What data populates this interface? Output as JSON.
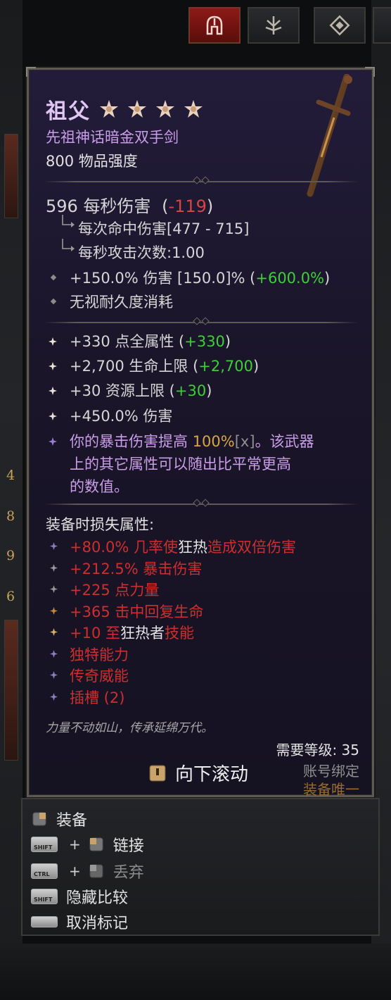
{
  "item": {
    "name": "祖父",
    "type": "先祖神话暗金双手剑",
    "power": "800 物品强度",
    "stars": 4
  },
  "dps": {
    "value": "596 每秒伤害",
    "diff_open": "(",
    "diff": "-119",
    "diff_close": ")",
    "hit_damage": "每次命中伤害[477 - 715]",
    "attacks_per_second": "每秒攻击次数:1.00"
  },
  "implicit": [
    {
      "prefix": "+150.0% 伤害 [150.0]% (",
      "green": "+600.0%",
      "suffix": ")"
    },
    {
      "prefix": "无视耐久度消耗",
      "green": "",
      "suffix": ""
    }
  ],
  "affixes": [
    {
      "prefix": "+330 点全属性 (",
      "green": "+330",
      "suffix": ")"
    },
    {
      "prefix": "+2,700 生命上限 (",
      "green": "+2,700",
      "suffix": ")"
    },
    {
      "prefix": "+30 资源上限 (",
      "green": "+30",
      "suffix": ")"
    },
    {
      "prefix": "+450.0% 伤害",
      "green": "",
      "suffix": ""
    }
  ],
  "unique_power": {
    "line1_a": "你的暴击伤害提高 ",
    "line1_b": "100%",
    "line1_c": "[x]",
    "line1_d": "。该武器",
    "line2": "上的其它属性可以随出比平常更高",
    "line3": "的数值。"
  },
  "lost_header": "装备时损失属性:",
  "lost": [
    {
      "parts": [
        [
          "+80.0% 几率使",
          "r"
        ],
        [
          "狂热",
          "w"
        ],
        [
          "造成双倍伤害",
          "r"
        ]
      ]
    },
    {
      "parts": [
        [
          "+212.5% 暴击伤害",
          "r"
        ]
      ]
    },
    {
      "parts": [
        [
          "+225 点力量",
          "r"
        ]
      ]
    },
    {
      "parts": [
        [
          "+365 击中回复生命",
          "r"
        ]
      ]
    },
    {
      "parts": [
        [
          "+10 至",
          "r"
        ],
        [
          "狂热者",
          "w"
        ],
        [
          "技能",
          "r"
        ]
      ]
    },
    {
      "parts": [
        [
          "独特能力",
          "r"
        ]
      ]
    },
    {
      "parts": [
        [
          "传奇威能",
          "r"
        ]
      ]
    },
    {
      "parts": [
        [
          "插槽 (2)",
          "r"
        ]
      ]
    }
  ],
  "flavor": "力量不动如山，传承延绵万代。",
  "requirements": {
    "level": "需要等级: 35",
    "account_bound": "账号绑定",
    "unique_equipped": "装备唯一"
  },
  "scroll_down": "向下滚动",
  "actions": {
    "equip": "装备",
    "link": "链接",
    "drop": "丢弃",
    "hide_compare": "隐藏比较",
    "unmark": "取消标记",
    "shift_label": "SHIFT",
    "ctrl_label": "CTRL",
    "plus": "+"
  },
  "side_numbers": [
    "4",
    "8",
    "9",
    "6"
  ],
  "colors": {
    "title": "#e0c6f2",
    "green": "#3fce3a",
    "red": "#cc2f2f",
    "gold": "#d6a548",
    "purple": "#c99de8"
  }
}
